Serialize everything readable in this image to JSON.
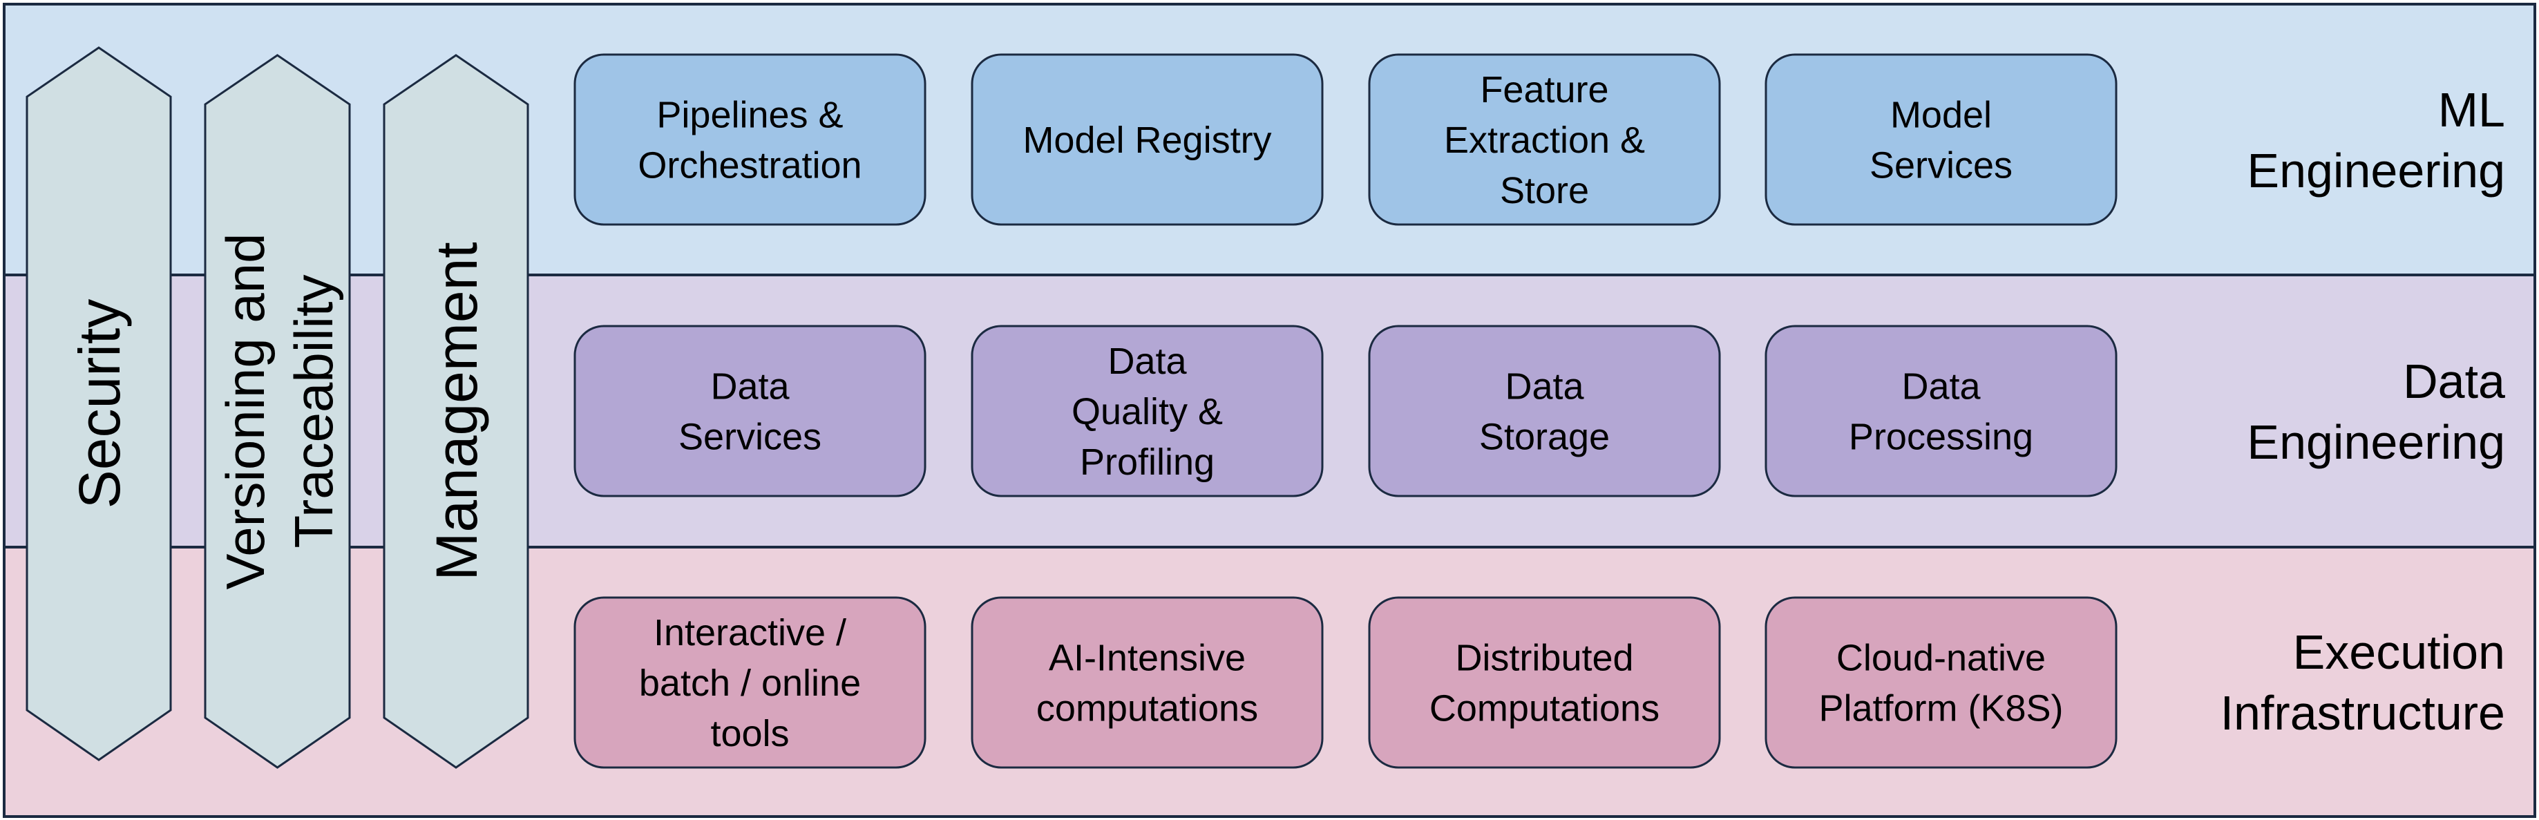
{
  "colors": {
    "outline": "#1b2a41",
    "pillar_fill": "#d0dfe3",
    "text": "#000000"
  },
  "layers": [
    {
      "label_lines": [
        "ML",
        "Engineering"
      ],
      "band_color": "#cfe1f2",
      "box_color": "#9fc4e7",
      "components": [
        {
          "lines": [
            "Pipelines &",
            "Orchestration"
          ]
        },
        {
          "lines": [
            "Model Registry"
          ]
        },
        {
          "lines": [
            "Feature",
            "Extraction &",
            "Store"
          ]
        },
        {
          "lines": [
            "Model",
            "Services"
          ]
        }
      ]
    },
    {
      "label_lines": [
        "Data",
        "Engineering"
      ],
      "band_color": "#d9d2e8",
      "box_color": "#b3a7d4",
      "components": [
        {
          "lines": [
            "Data",
            "Services"
          ]
        },
        {
          "lines": [
            "Data",
            "Quality &",
            "Profiling"
          ]
        },
        {
          "lines": [
            "Data",
            "Storage"
          ]
        },
        {
          "lines": [
            "Data",
            "Processing"
          ]
        }
      ]
    },
    {
      "label_lines": [
        "Execution",
        "Infrastructure"
      ],
      "band_color": "#ecd1dc",
      "box_color": "#d7a5bd",
      "components": [
        {
          "lines": [
            "Interactive /",
            "batch / online",
            "tools"
          ]
        },
        {
          "lines": [
            "AI-Intensive",
            "computations"
          ]
        },
        {
          "lines": [
            "Distributed",
            "Computations"
          ]
        },
        {
          "lines": [
            "Cloud-native",
            "Platform (K8S)"
          ]
        }
      ]
    }
  ],
  "pillars": [
    {
      "lines": [
        "Security"
      ]
    },
    {
      "lines": [
        "Versioning and",
        "Traceability"
      ]
    },
    {
      "lines": [
        "Management"
      ]
    }
  ]
}
